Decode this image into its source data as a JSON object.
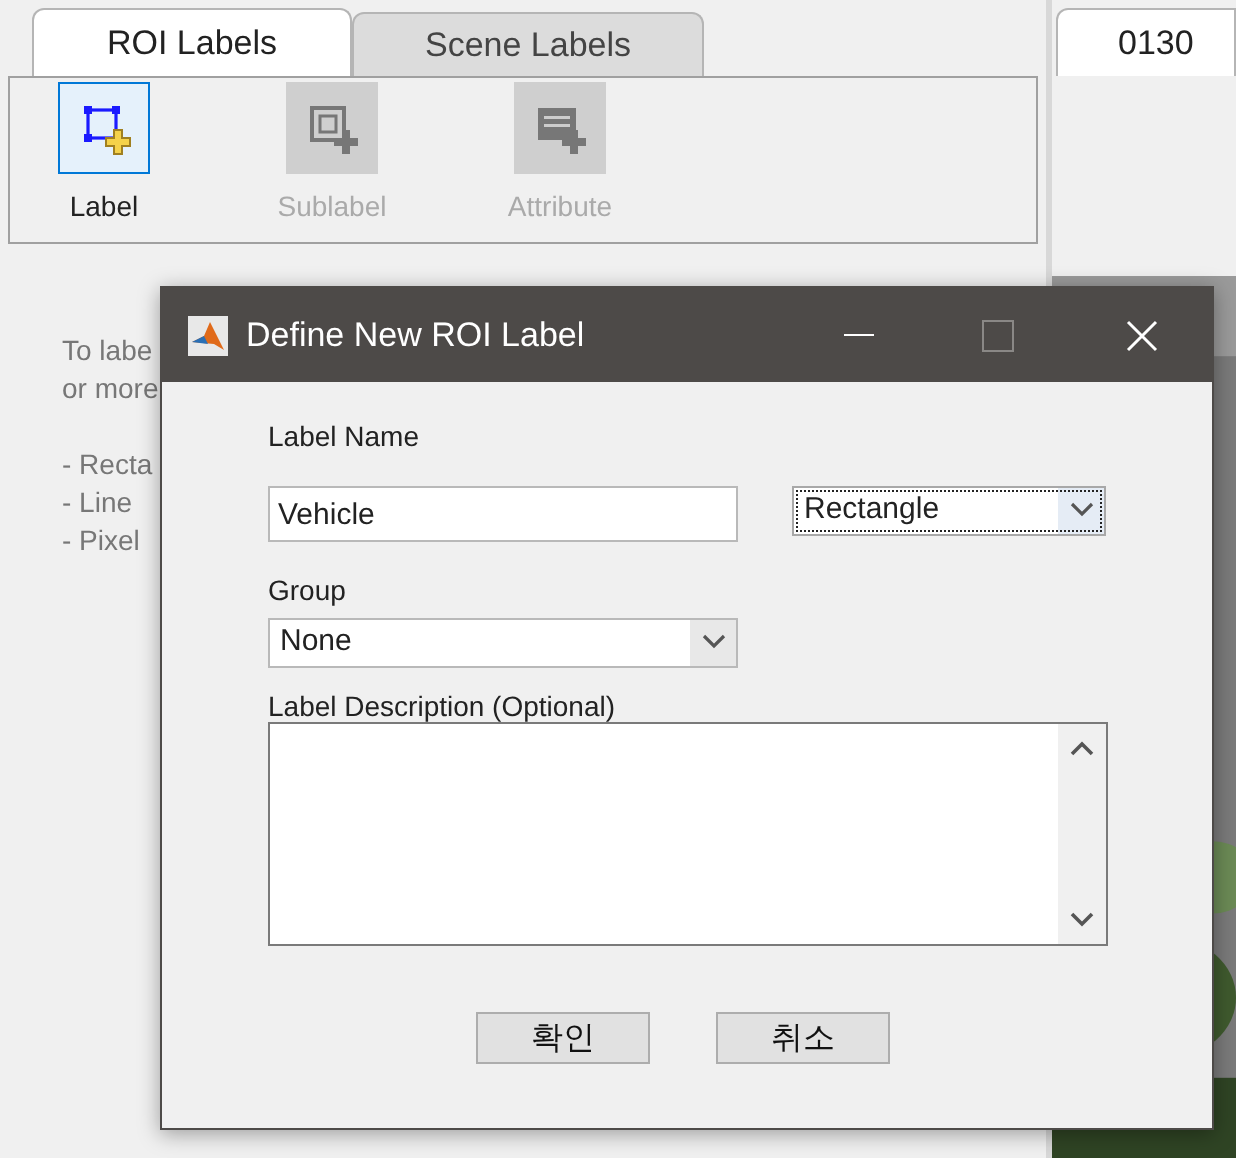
{
  "left_panel": {
    "tabs": [
      {
        "label": "ROI Labels",
        "selected": true
      },
      {
        "label": "Scene Labels",
        "selected": false
      }
    ],
    "tools": [
      {
        "kind": "label",
        "label": "Label",
        "selected": true,
        "disabled": false
      },
      {
        "kind": "sublabel",
        "label": "Sublabel",
        "selected": false,
        "disabled": true
      },
      {
        "kind": "attribute",
        "label": "Attribute",
        "selected": false,
        "disabled": true
      }
    ],
    "help_paragraphs": [
      [
        "To labe",
        "or more"
      ],
      [
        "- Recta",
        "- Line",
        "- Pixel"
      ]
    ]
  },
  "right_panel": {
    "tabs": [
      {
        "label": "0130",
        "selected": true
      }
    ]
  },
  "dialog": {
    "title": "Define New ROI Label",
    "label_name": {
      "label": "Label Name",
      "value": "Vehicle"
    },
    "type_dropdown": {
      "value": "Rectangle",
      "focused": true
    },
    "group": {
      "label": "Group",
      "value": "None"
    },
    "description": {
      "label": "Label Description (Optional)"
    },
    "buttons": [
      "확인",
      "취소"
    ]
  }
}
